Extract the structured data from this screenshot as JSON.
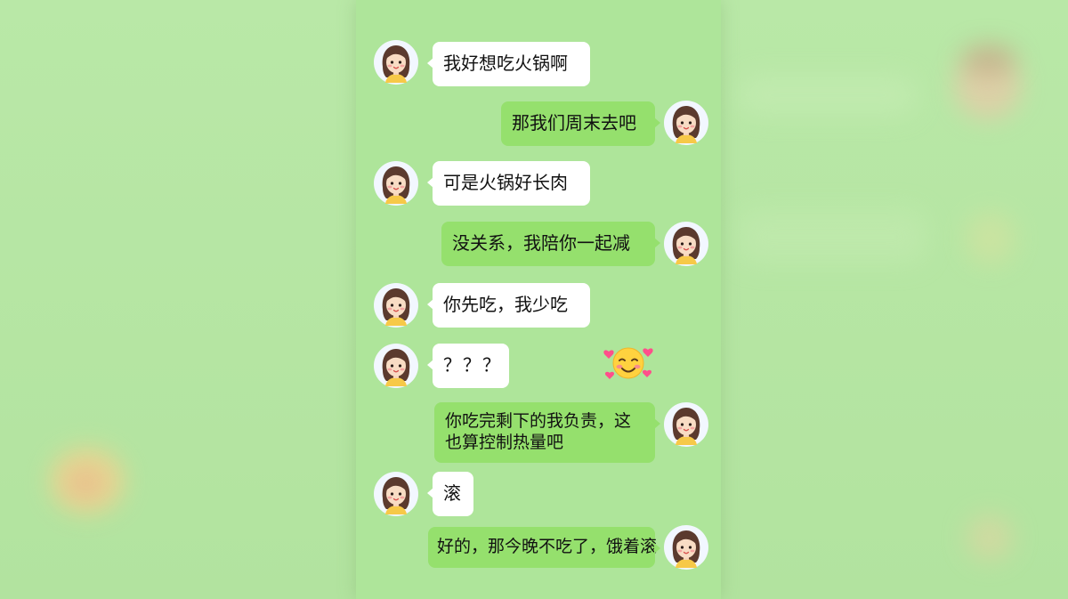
{
  "messages": [
    {
      "side": "left",
      "text": "我好想吃火锅啊"
    },
    {
      "side": "right",
      "text": "那我们周末去吧"
    },
    {
      "side": "left",
      "text": "可是火锅好长肉"
    },
    {
      "side": "right",
      "text": "没关系，我陪你一起减"
    },
    {
      "side": "left",
      "text": "你先吃，我少吃"
    },
    {
      "side": "left",
      "text": "？？？"
    },
    {
      "side": "right",
      "text": "你吃完剩下的我负责，这也算控制热量吧"
    },
    {
      "side": "left",
      "text": "滚"
    },
    {
      "side": "right",
      "text": "好的，那今晚不吃了，饿着滚"
    }
  ],
  "sticker": {
    "icon": "smiling-face-with-hearts-icon"
  },
  "colors": {
    "background": "#b6e6a3",
    "panel": "#aee59a",
    "bubble_left": "#ffffff",
    "bubble_right": "#95e06d"
  }
}
